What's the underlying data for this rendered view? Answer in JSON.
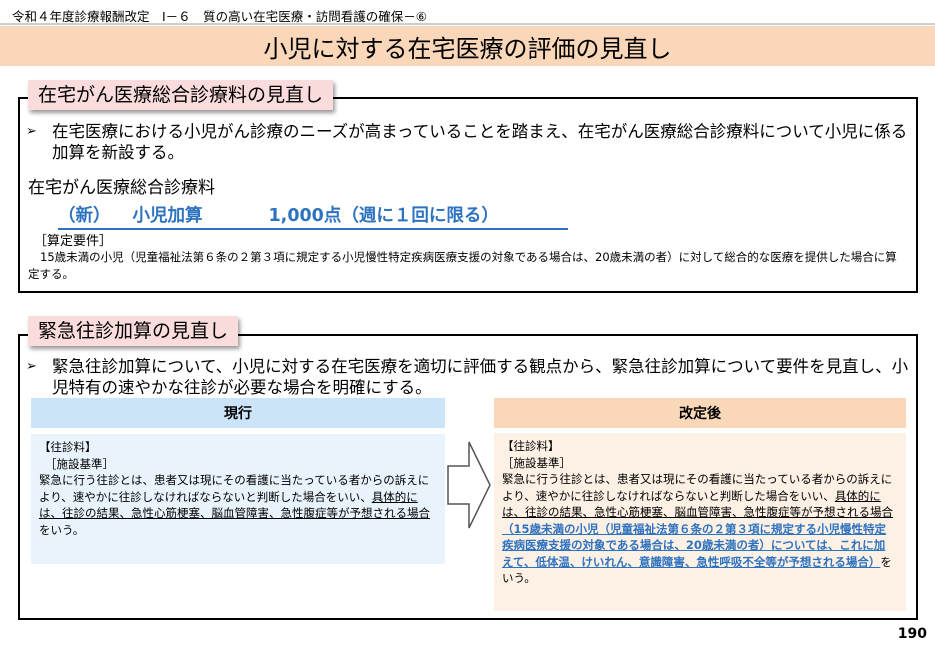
{
  "header": {
    "note": "令和４年度診療報酬改定　Ⅰ－６　質の高い在宅医療・訪問看護の確保－⑥",
    "title": "小児に対する在宅医療の評価の見直し"
  },
  "section1": {
    "tab": "在宅がん医療総合診療料の見直し",
    "bullet_mark": "➢",
    "bullet": "在宅医療における小児がん診療のニーズが高まっていることを踏まえ、在宅がん医療総合診療料について小児に係る加算を新設する。",
    "subheading": "在宅がん医療総合診療料",
    "new_tag": "（新）",
    "new_name": "小児加算",
    "new_points": "1,000点（週に１回に限る）",
    "req_label": "［算定要件］",
    "req_text": "15歳未満の小児（児童福祉法第６条の２第３項に規定する小児慢性特定疾病医療支援の対象である場合は、20歳未満の者）に対して総合的な医療を提供した場合に算定する。"
  },
  "section2": {
    "tab": "緊急往診加算の見直し",
    "bullet_mark": "➢",
    "bullet": "緊急往診加算について、小児に対する在宅医療を適切に評価する観点から、緊急往診加算について要件を見直し、小児特有の速やかな往診が必要な場合を明確にする。",
    "current": {
      "header": "現行",
      "label1": "【往診料】",
      "label2": "［施設基準］",
      "body_plain": "緊急に行う往診とは、患者又は現にその看護に当たっている者からの訴えにより、速やかに往診しなければならないと判断した場合をいい、",
      "body_underlined": "具体的には、往診の結果、急性心筋梗塞、脳血管障害、急性腹症等が予想される場合",
      "body_end": "をいう。"
    },
    "revised": {
      "header": "改定後",
      "label1": "【往診料】",
      "label2": "［施設基準］",
      "body_plain": "緊急に行う往診とは、患者又は現にその看護に当たっている者からの訴えにより、速やかに往診しなければならないと判断した場合をいい、",
      "body_underlined": "具体的には、往診の結果、急性心筋梗塞、脳血管障害、急性腹症等が予想される場合",
      "body_added": "（15歳未満の小児（児童福祉法第６条の２第３項に規定する小児慢性特定疾病医療支援の対象である場合は、20歳未満の者）については、これに加えて、低体温、けいれん、意識障害、急性呼吸不全等が予想される場合）",
      "body_end": "をいう。"
    }
  },
  "page_number": "190",
  "colors": {
    "title_banner": "#fad7b9",
    "tab_pink": "#fadcdc",
    "blue_text": "#2e73c0",
    "current_header": "#cce4f7",
    "current_panel": "#e8f3fc",
    "revised_header": "#fad7b9",
    "revised_panel": "#fdf0e4"
  },
  "icons": {
    "arrow": "right-arrow-outline-icon"
  }
}
